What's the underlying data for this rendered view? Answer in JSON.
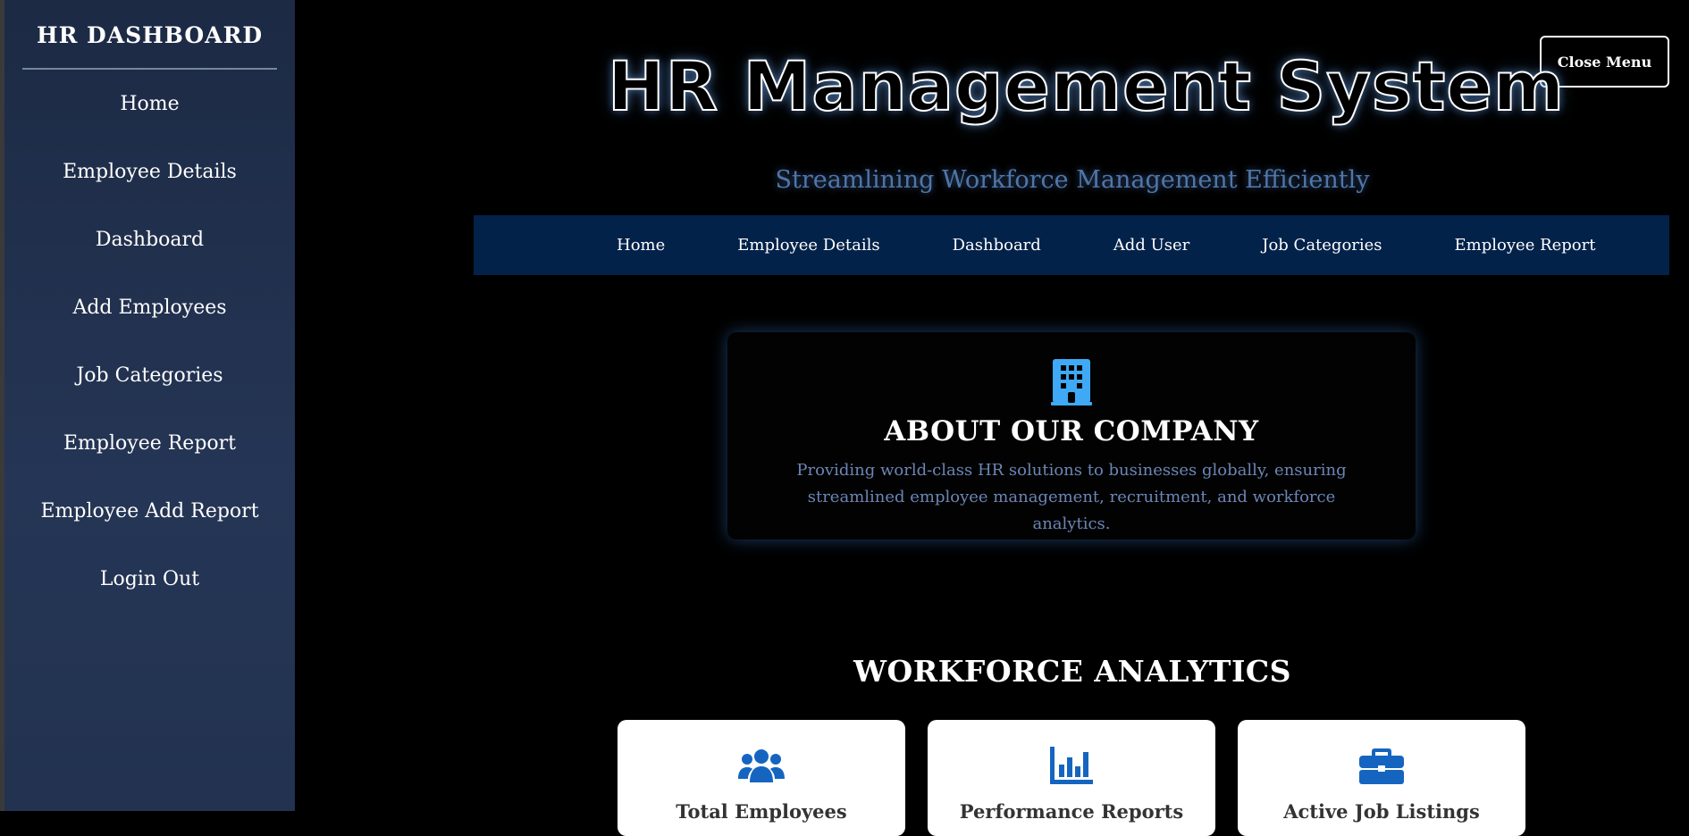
{
  "sidebar": {
    "title": "HR DASHBOARD",
    "items": [
      {
        "label": "Home"
      },
      {
        "label": "Employee Details"
      },
      {
        "label": "Dashboard"
      },
      {
        "label": "Add Employees"
      },
      {
        "label": "Job Categories"
      },
      {
        "label": "Employee Report"
      },
      {
        "label": "Employee Add Report"
      },
      {
        "label": "Login Out"
      }
    ]
  },
  "header": {
    "close_menu_label": "Close Menu",
    "title": "HR Management System",
    "subtitle": "Streamlining Workforce Management Efficiently"
  },
  "topnav": {
    "items": [
      {
        "label": "Home"
      },
      {
        "label": "Employee Details"
      },
      {
        "label": "Dashboard"
      },
      {
        "label": "Add User"
      },
      {
        "label": "Job Categories"
      },
      {
        "label": "Employee Report"
      }
    ]
  },
  "about": {
    "icon": "building-icon",
    "title": "ABOUT OUR COMPANY",
    "text": "Providing world-class HR solutions to businesses globally, ensuring streamlined employee management, recruitment, and workforce analytics."
  },
  "analytics": {
    "title": "WORKFORCE ANALYTICS",
    "cards": [
      {
        "icon": "users-icon",
        "label": "Total Employees"
      },
      {
        "icon": "chart-bar-icon",
        "label": "Performance Reports"
      },
      {
        "icon": "briefcase-icon",
        "label": "Active Job Listings"
      }
    ]
  },
  "colors": {
    "sidebar_bg": "#223250",
    "nav_bg": "#03224a",
    "accent_icon": "#3fa9f5",
    "card_icon": "#1565c0",
    "subtitle": "#4f76a8"
  }
}
